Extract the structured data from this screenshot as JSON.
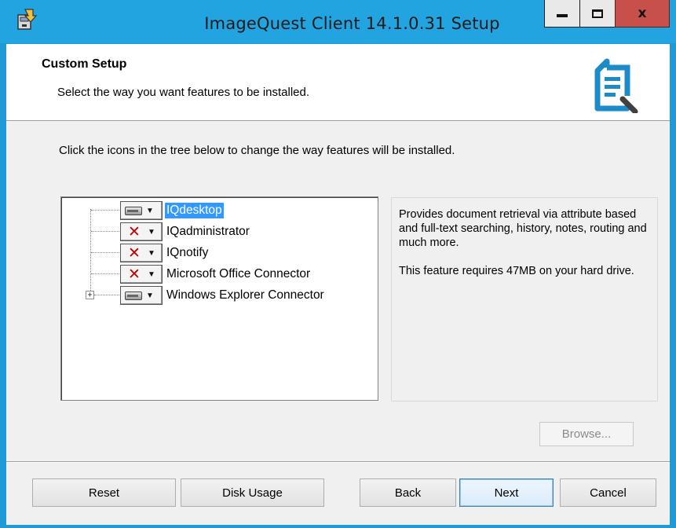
{
  "window": {
    "title": "ImageQuest Client 14.1.0.31 Setup",
    "minimize_glyph": "▁",
    "maximize_glyph": "□",
    "close_glyph": "x"
  },
  "header": {
    "title": "Custom Setup",
    "subtitle": "Select the way you want features to be installed."
  },
  "instruction": "Click the icons in the tree below to change the way features will be installed.",
  "tree": {
    "items": [
      {
        "label": "IQdesktop",
        "state": "installed",
        "icon": "hard-drive-icon",
        "selected": true
      },
      {
        "label": "IQadministrator",
        "state": "not-installed",
        "icon": "red-x-icon",
        "selected": false
      },
      {
        "label": "IQnotify",
        "state": "not-installed",
        "icon": "red-x-icon",
        "selected": false
      },
      {
        "label": "Microsoft Office Connector",
        "state": "not-installed",
        "icon": "red-x-icon",
        "selected": false
      },
      {
        "label": "Windows Explorer Connector",
        "state": "installed",
        "icon": "hard-drive-icon",
        "selected": false,
        "expandable": true
      }
    ],
    "expander_glyph": "+",
    "dropdown_glyph": "▼",
    "x_glyph": "✕"
  },
  "description": {
    "text": "Provides document retrieval via attribute based and full-text searching, history, notes, routing and much more.",
    "size_text": "This feature requires 47MB on your hard drive."
  },
  "buttons": {
    "browse": "Browse...",
    "reset": "Reset",
    "disk_usage": "Disk Usage",
    "back": "Back",
    "next": "Next",
    "cancel": "Cancel"
  },
  "colors": {
    "titlebar": "#21a4e0",
    "selection": "#3399ff",
    "close_button": "#c7504b",
    "red_x": "#c00000"
  }
}
